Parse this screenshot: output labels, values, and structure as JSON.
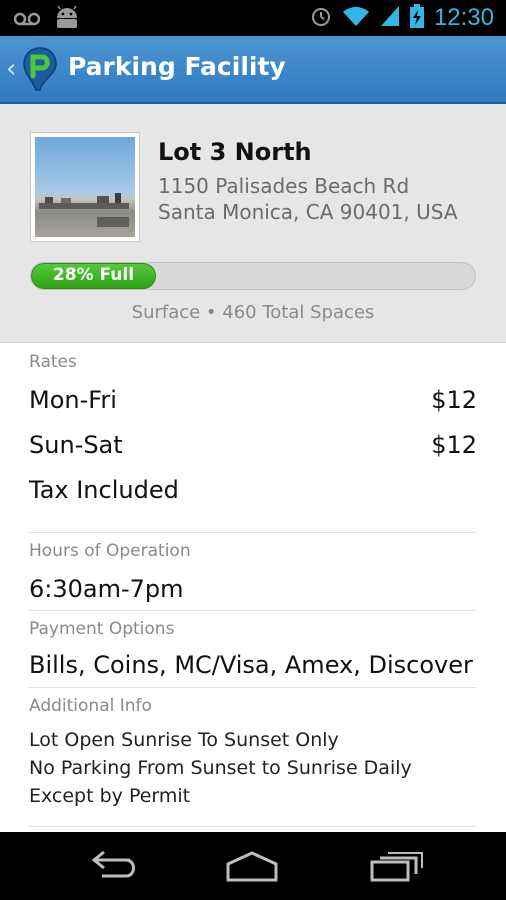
{
  "status_bar": {
    "time": "12:30",
    "icons": [
      "voicemail-icon",
      "android-icon",
      "alarm-icon",
      "wifi-icon",
      "signal-icon",
      "battery-charging-icon"
    ]
  },
  "action_bar": {
    "title": "Parking Facility",
    "back_icon": "back-caret-icon",
    "logo_icon": "parking-app-logo-icon",
    "colors": {
      "bar": "#3c86c9",
      "title": "#ffffff"
    }
  },
  "facility": {
    "name": "Lot 3 North",
    "address_line1": "1150 Palisades Beach Rd",
    "address_line2": "Santa Monica, CA 90401, USA",
    "occupancy_label": "28% Full",
    "occupancy_fraction": 0.28,
    "summary": "Surface • 460 Total Spaces",
    "colors": {
      "progress": "#3cb521"
    }
  },
  "rates": {
    "heading": "Rates",
    "items": [
      {
        "label": "Mon-Fri",
        "value": "$12"
      },
      {
        "label": "Sun-Sat",
        "value": "$12"
      }
    ],
    "tax_note": "Tax Included"
  },
  "hours": {
    "heading": "Hours of Operation",
    "value": "6:30am-7pm"
  },
  "payment": {
    "heading": "Payment Options",
    "value": "Bills, Coins, MC/Visa, Amex, Discover"
  },
  "additional": {
    "heading": "Additional Info",
    "lines": [
      "Lot Open Sunrise To Sunset Only",
      "No Parking From Sunset to Sunrise Daily",
      "Except by Permit"
    ]
  },
  "nav_bar": {
    "icons": [
      "back-nav-icon",
      "home-nav-icon",
      "recent-apps-icon"
    ]
  }
}
